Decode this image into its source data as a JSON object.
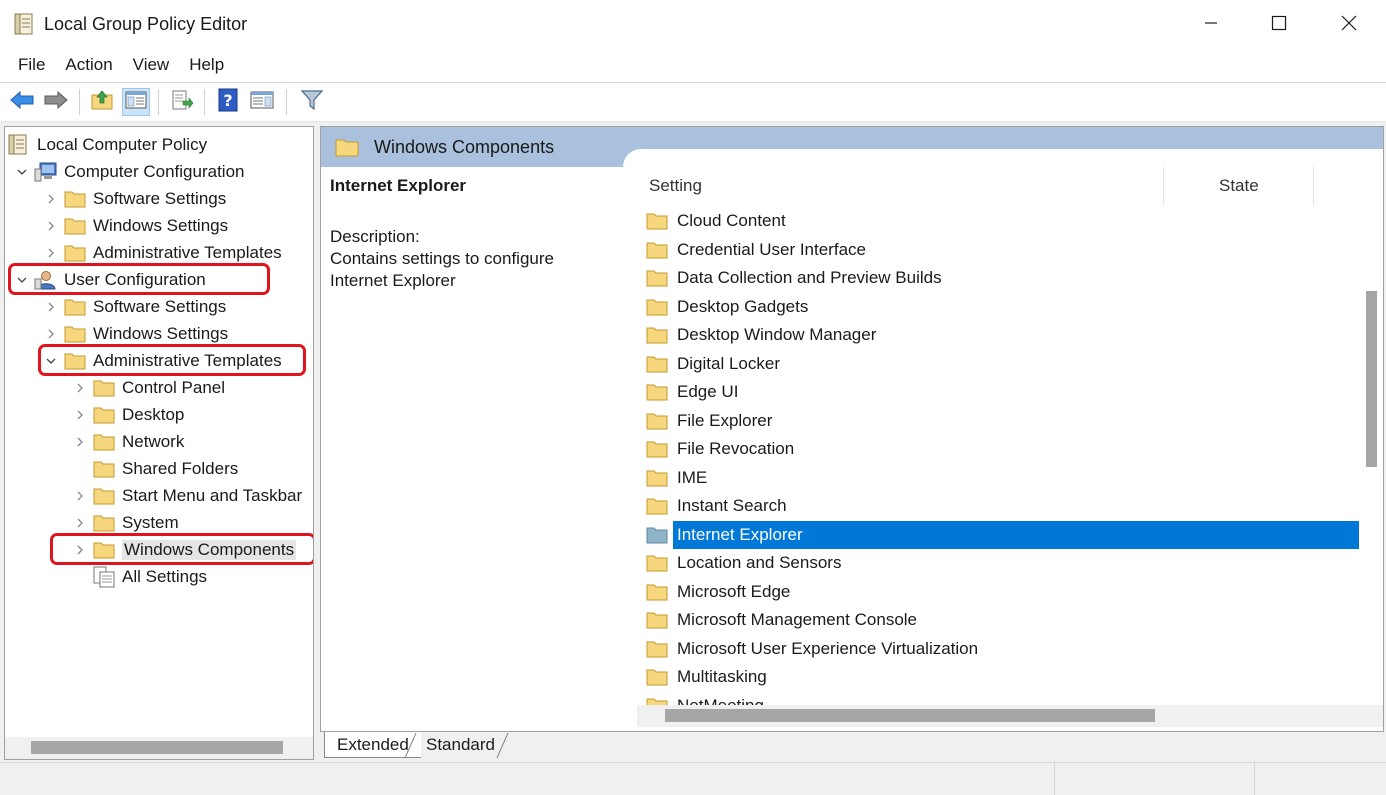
{
  "window": {
    "title": "Local Group Policy Editor",
    "icons": {
      "app": "policy-document-icon",
      "minimize": "minimize-icon",
      "maximize": "maximize-icon",
      "close": "close-icon"
    }
  },
  "menu": {
    "items": [
      "File",
      "Action",
      "View",
      "Help"
    ]
  },
  "toolbar": {
    "buttons": [
      {
        "icon": "back-arrow-icon"
      },
      {
        "icon": "forward-arrow-icon"
      },
      {
        "icon": "up-folder-icon"
      },
      {
        "icon": "show-hide-console-tree-icon"
      },
      {
        "icon": "export-list-icon"
      },
      {
        "icon": "help-icon"
      },
      {
        "icon": "show-hide-action-pane-icon"
      },
      {
        "icon": "filter-icon"
      }
    ]
  },
  "tree": {
    "items": [
      {
        "label": "Local Computer Policy",
        "icon": "policy-document-icon",
        "level": 0,
        "chevron": "none"
      },
      {
        "label": "Computer Configuration",
        "icon": "computer-icon",
        "level": 1,
        "chevron": "expanded"
      },
      {
        "label": "Software Settings",
        "icon": "folder-icon",
        "level": 2,
        "chevron": "collapsed"
      },
      {
        "label": "Windows Settings",
        "icon": "folder-icon",
        "level": 2,
        "chevron": "collapsed"
      },
      {
        "label": "Administrative Templates",
        "icon": "folder-icon",
        "level": 2,
        "chevron": "collapsed"
      },
      {
        "label": "User Configuration",
        "icon": "user-icon",
        "level": 1,
        "chevron": "expanded",
        "highlighted": true
      },
      {
        "label": "Software Settings",
        "icon": "folder-icon",
        "level": 2,
        "chevron": "collapsed"
      },
      {
        "label": "Windows Settings",
        "icon": "folder-icon",
        "level": 2,
        "chevron": "collapsed"
      },
      {
        "label": "Administrative Templates",
        "icon": "folder-icon",
        "level": 2,
        "chevron": "expanded",
        "highlighted": true
      },
      {
        "label": "Control Panel",
        "icon": "folder-icon",
        "level": 3,
        "chevron": "collapsed"
      },
      {
        "label": "Desktop",
        "icon": "folder-icon",
        "level": 3,
        "chevron": "collapsed"
      },
      {
        "label": "Network",
        "icon": "folder-icon",
        "level": 3,
        "chevron": "collapsed"
      },
      {
        "label": "Shared Folders",
        "icon": "folder-icon",
        "level": 3,
        "chevron": "none"
      },
      {
        "label": "Start Menu and Taskbar",
        "icon": "folder-icon",
        "level": 3,
        "chevron": "collapsed"
      },
      {
        "label": "System",
        "icon": "folder-icon",
        "level": 3,
        "chevron": "collapsed"
      },
      {
        "label": "Windows Components",
        "icon": "folder-icon",
        "level": 3,
        "chevron": "collapsed",
        "highlighted": true,
        "selected": true
      },
      {
        "label": "All Settings",
        "icon": "all-settings-icon",
        "level": 3,
        "chevron": "none"
      }
    ]
  },
  "right_pane": {
    "header_title": "Windows Components",
    "header_icon": "folder-icon",
    "description": {
      "title": "Internet Explorer",
      "label": "Description:",
      "text": "Contains settings to configure Internet Explorer"
    },
    "columns": [
      "Setting",
      "State"
    ],
    "items": [
      {
        "label": "Cloud Content",
        "icon": "folder-icon"
      },
      {
        "label": "Credential User Interface",
        "icon": "folder-icon"
      },
      {
        "label": "Data Collection and Preview Builds",
        "icon": "folder-icon"
      },
      {
        "label": "Desktop Gadgets",
        "icon": "folder-icon"
      },
      {
        "label": "Desktop Window Manager",
        "icon": "folder-icon"
      },
      {
        "label": "Digital Locker",
        "icon": "folder-icon"
      },
      {
        "label": "Edge UI",
        "icon": "folder-icon"
      },
      {
        "label": "File Explorer",
        "icon": "folder-icon"
      },
      {
        "label": "File Revocation",
        "icon": "folder-icon"
      },
      {
        "label": "IME",
        "icon": "folder-icon"
      },
      {
        "label": "Instant Search",
        "icon": "folder-icon"
      },
      {
        "label": "Internet Explorer",
        "icon": "folder-icon",
        "selected": true
      },
      {
        "label": "Location and Sensors",
        "icon": "folder-icon"
      },
      {
        "label": "Microsoft Edge",
        "icon": "folder-icon"
      },
      {
        "label": "Microsoft Management Console",
        "icon": "folder-icon"
      },
      {
        "label": "Microsoft User Experience Virtualization",
        "icon": "folder-icon"
      },
      {
        "label": "Multitasking",
        "icon": "folder-icon"
      },
      {
        "label": "NetMeeting",
        "icon": "folder-icon"
      }
    ]
  },
  "tabs": [
    "Extended",
    "Standard"
  ],
  "colors": {
    "selection": "#0078d7",
    "highlight_box": "#e0141e",
    "header_band": "#a9c1dc",
    "folder": "#f6d77e"
  }
}
